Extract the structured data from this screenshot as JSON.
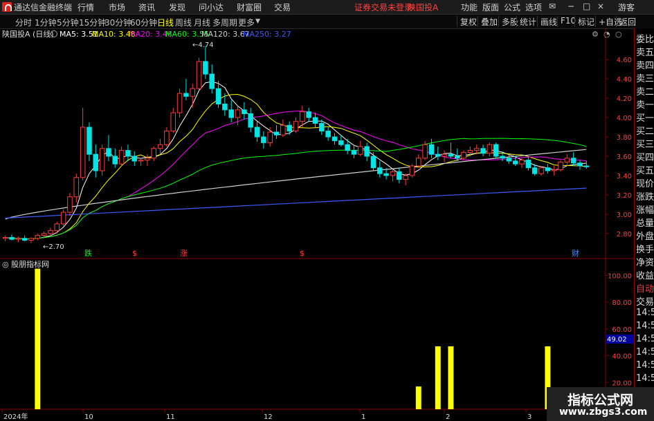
{
  "menubar": {
    "app_title": "通达信金融终端",
    "items": [
      "行情",
      "市场",
      "资讯",
      "发现",
      "问小达",
      "财富圈",
      "交易"
    ],
    "status_text": "证券交易未登录",
    "stock_name": "陕国投A",
    "right_items": [
      "功能",
      "版面",
      "公式",
      "选项"
    ],
    "user": "游客"
  },
  "periodbar": {
    "tabs": [
      "分时",
      "1分钟",
      "5分钟",
      "15分钟",
      "30分钟",
      "60分钟",
      "日线",
      "周线",
      "月线",
      "多周期",
      "更多"
    ],
    "active": "日线",
    "tools": [
      "复权",
      "叠加",
      "多股",
      "统计",
      "画线",
      "F10",
      "标记",
      "+自选",
      "返回"
    ]
  },
  "chart_header": {
    "name": "陕国投A (日线)",
    "ma5": "MA5: 3.51",
    "ma10": "MA10: 3.48",
    "ma20": "MA20: 3.48",
    "ma60": "MA60: 3.55",
    "ma120": "MA120: 3.67",
    "ma250": "MA250: 3.27",
    "ma_colors": {
      "ma5": "#ffffff",
      "ma10": "#ffff00",
      "ma20": "#ff00ff",
      "ma60": "#00ff00",
      "ma120": "#d0d0d0",
      "ma250": "#3d5bff"
    }
  },
  "indicator_header": "股朋指标网",
  "time_labels": [
    "2024年",
    "10",
    "11",
    "12",
    "1",
    "2",
    "3"
  ],
  "markers": {
    "die": "跌",
    "s": "$",
    "zhang": "涨",
    "cai": "财"
  },
  "sidebar": {
    "items": [
      "委比",
      "卖五",
      "卖四",
      "卖三",
      "卖二",
      "卖一",
      "买一",
      "买二",
      "买三",
      "买四",
      "买五",
      "现价",
      "涨跌",
      "涨幅",
      "总量",
      "外盘",
      "换手",
      "净资",
      "收益",
      "自动",
      "交易",
      "14:56",
      "14:56",
      "14:56",
      "14:56",
      "14:56",
      "14:56",
      "14:56",
      "14:56"
    ]
  },
  "indicator_value": "49.02",
  "watermark": {
    "line1": "指标公式网",
    "line2": "www.zbgs3.com"
  },
  "chart_data": [
    {
      "type": "candlestick",
      "title": "陕国投A (日线)",
      "ylim": [
        2.62,
        4.78
      ],
      "yticks": [
        2.8,
        3.0,
        3.2,
        3.4,
        3.6,
        3.8,
        4.0,
        4.2,
        4.4,
        4.6
      ],
      "annotations": [
        {
          "text": "4.74",
          "type": "high"
        },
        {
          "text": "2.70",
          "type": "low"
        }
      ],
      "ohlc": [
        [
          2.75,
          2.78,
          2.72,
          2.76
        ],
        [
          2.76,
          2.79,
          2.73,
          2.74
        ],
        [
          2.74,
          2.77,
          2.71,
          2.75
        ],
        [
          2.75,
          2.78,
          2.72,
          2.73
        ],
        [
          2.73,
          2.76,
          2.7,
          2.75
        ],
        [
          2.75,
          2.8,
          2.73,
          2.78
        ],
        [
          2.78,
          2.82,
          2.75,
          2.8
        ],
        [
          2.8,
          2.86,
          2.77,
          2.83
        ],
        [
          2.83,
          2.92,
          2.8,
          2.9
        ],
        [
          2.9,
          3.05,
          2.88,
          3.02
        ],
        [
          3.02,
          3.22,
          2.98,
          3.18
        ],
        [
          3.18,
          3.42,
          3.12,
          3.38
        ],
        [
          3.38,
          4.1,
          3.35,
          3.9
        ],
        [
          3.9,
          3.95,
          3.55,
          3.62
        ],
        [
          3.62,
          3.72,
          3.38,
          3.45
        ],
        [
          3.45,
          3.72,
          3.4,
          3.68
        ],
        [
          3.68,
          3.82,
          3.55,
          3.6
        ],
        [
          3.6,
          3.68,
          3.48,
          3.52
        ],
        [
          3.52,
          3.7,
          3.5,
          3.66
        ],
        [
          3.66,
          3.72,
          3.55,
          3.6
        ],
        [
          3.6,
          3.65,
          3.5,
          3.55
        ],
        [
          3.55,
          3.58,
          3.5,
          3.56
        ],
        [
          3.56,
          3.62,
          3.5,
          3.58
        ],
        [
          3.58,
          3.7,
          3.55,
          3.68
        ],
        [
          3.68,
          3.78,
          3.62,
          3.72
        ],
        [
          3.72,
          3.9,
          3.7,
          3.86
        ],
        [
          3.86,
          4.1,
          3.84,
          4.05
        ],
        [
          4.05,
          4.3,
          4.0,
          4.25
        ],
        [
          4.25,
          4.4,
          4.18,
          4.22
        ],
        [
          4.22,
          4.35,
          4.1,
          4.3
        ],
        [
          4.3,
          4.62,
          4.28,
          4.58
        ],
        [
          4.58,
          4.74,
          4.4,
          4.45
        ],
        [
          4.45,
          4.55,
          4.25,
          4.3
        ],
        [
          4.3,
          4.38,
          4.1,
          4.14
        ],
        [
          4.14,
          4.25,
          4.02,
          4.08
        ],
        [
          4.08,
          4.18,
          3.95,
          4.0
        ],
        [
          4.0,
          4.12,
          3.92,
          4.08
        ],
        [
          4.08,
          4.16,
          3.98,
          4.04
        ],
        [
          4.04,
          4.1,
          3.85,
          3.9
        ],
        [
          3.9,
          3.96,
          3.75,
          3.8
        ],
        [
          3.8,
          3.86,
          3.68,
          3.74
        ],
        [
          3.74,
          3.9,
          3.7,
          3.85
        ],
        [
          3.85,
          3.92,
          3.78,
          3.82
        ],
        [
          3.82,
          3.98,
          3.8,
          3.92
        ],
        [
          3.92,
          3.96,
          3.82,
          3.86
        ],
        [
          3.86,
          4.0,
          3.84,
          3.96
        ],
        [
          3.96,
          4.12,
          3.9,
          4.06
        ],
        [
          4.06,
          4.1,
          3.96,
          4.0
        ],
        [
          4.0,
          4.05,
          3.9,
          3.94
        ],
        [
          3.94,
          3.98,
          3.82,
          3.86
        ],
        [
          3.86,
          3.9,
          3.76,
          3.8
        ],
        [
          3.8,
          3.84,
          3.72,
          3.76
        ],
        [
          3.76,
          3.82,
          3.7,
          3.72
        ],
        [
          3.72,
          3.78,
          3.62,
          3.66
        ],
        [
          3.66,
          3.72,
          3.58,
          3.62
        ],
        [
          3.62,
          3.76,
          3.6,
          3.7
        ],
        [
          3.7,
          3.74,
          3.55,
          3.6
        ],
        [
          3.6,
          3.64,
          3.45,
          3.48
        ],
        [
          3.48,
          3.55,
          3.38,
          3.42
        ],
        [
          3.42,
          3.48,
          3.36,
          3.4
        ],
        [
          3.4,
          3.46,
          3.34,
          3.44
        ],
        [
          3.44,
          3.48,
          3.32,
          3.36
        ],
        [
          3.36,
          3.42,
          3.3,
          3.4
        ],
        [
          3.4,
          3.52,
          3.38,
          3.5
        ],
        [
          3.5,
          3.62,
          3.48,
          3.58
        ],
        [
          3.58,
          3.76,
          3.56,
          3.72
        ],
        [
          3.72,
          3.78,
          3.58,
          3.62
        ],
        [
          3.62,
          3.7,
          3.56,
          3.6
        ],
        [
          3.6,
          3.66,
          3.54,
          3.62
        ],
        [
          3.62,
          3.74,
          3.58,
          3.6
        ],
        [
          3.6,
          3.68,
          3.55,
          3.58
        ],
        [
          3.58,
          3.66,
          3.56,
          3.64
        ],
        [
          3.64,
          3.7,
          3.6,
          3.66
        ],
        [
          3.66,
          3.72,
          3.62,
          3.68
        ],
        [
          3.68,
          3.72,
          3.6,
          3.63
        ],
        [
          3.63,
          3.74,
          3.6,
          3.72
        ],
        [
          3.72,
          3.74,
          3.58,
          3.6
        ],
        [
          3.6,
          3.64,
          3.55,
          3.58
        ],
        [
          3.58,
          3.62,
          3.52,
          3.55
        ],
        [
          3.55,
          3.6,
          3.5,
          3.52
        ],
        [
          3.52,
          3.58,
          3.48,
          3.56
        ],
        [
          3.56,
          3.6,
          3.45,
          3.48
        ],
        [
          3.48,
          3.52,
          3.4,
          3.42
        ],
        [
          3.42,
          3.5,
          3.4,
          3.48
        ],
        [
          3.48,
          3.52,
          3.42,
          3.45
        ],
        [
          3.45,
          3.5,
          3.4,
          3.46
        ],
        [
          3.46,
          3.56,
          3.44,
          3.54
        ],
        [
          3.54,
          3.62,
          3.5,
          3.58
        ],
        [
          3.58,
          3.64,
          3.5,
          3.53
        ],
        [
          3.53,
          3.56,
          3.46,
          3.5
        ],
        [
          3.5,
          3.55,
          3.47,
          3.49
        ]
      ]
    },
    {
      "type": "bar",
      "title": "股朋指标网",
      "ylim": [
        0,
        110
      ],
      "yticks": [
        20,
        40,
        60,
        80,
        100
      ],
      "values": [
        0,
        0,
        0,
        0,
        0,
        0,
        0,
        0,
        0,
        0,
        0,
        0,
        0,
        0,
        0,
        0,
        0,
        0,
        0,
        0,
        0,
        0,
        0,
        0,
        0,
        0,
        0,
        0,
        0,
        0,
        0,
        0,
        0,
        0,
        0,
        0,
        0,
        0,
        0,
        0,
        0,
        0,
        0,
        0,
        0,
        0,
        0,
        0,
        0,
        0,
        0,
        0,
        0,
        0,
        0,
        0,
        0,
        0,
        0,
        0,
        0,
        0,
        0,
        0,
        0,
        0,
        0,
        0,
        0,
        0,
        0,
        0,
        0,
        0,
        0,
        0,
        0,
        0,
        0,
        0,
        0,
        0,
        0,
        0,
        0,
        0,
        0,
        0,
        0,
        0,
        0
      ],
      "bars": [
        {
          "index": 5,
          "value": 105
        },
        {
          "index": 64,
          "value": 17
        },
        {
          "index": 67,
          "value": 47
        },
        {
          "index": 69,
          "value": 47
        },
        {
          "index": 84,
          "value": 47
        }
      ],
      "last_value": 49.02
    }
  ]
}
